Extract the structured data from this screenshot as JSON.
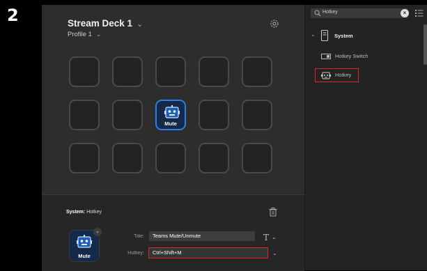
{
  "step_number": "2",
  "deck": {
    "title": "Stream Deck 1",
    "profile": "Profile 1"
  },
  "keys": [
    {
      "label": ""
    },
    {
      "label": ""
    },
    {
      "label": ""
    },
    {
      "label": ""
    },
    {
      "label": ""
    },
    {
      "label": ""
    },
    {
      "label": ""
    },
    {
      "label": "Mute",
      "icon": "robot-icon"
    },
    {
      "label": ""
    },
    {
      "label": ""
    },
    {
      "label": ""
    },
    {
      "label": ""
    },
    {
      "label": ""
    },
    {
      "label": ""
    },
    {
      "label": ""
    }
  ],
  "inspector": {
    "category": "System:",
    "action": "Hotkey",
    "preview_label": "Mute",
    "title_label": "Title:",
    "title_value": "Teams Mute/Unmute",
    "hotkey_label": "Hotkey:",
    "hotkey_value": "Ctrl+Shift+M"
  },
  "actions_panel": {
    "search_value": "Hotkey",
    "category": "System",
    "items": [
      {
        "label": "Hotkey Switch",
        "icon": "hotkey-switch-icon"
      },
      {
        "label": "Hotkey",
        "icon": "hotkey-icon",
        "highlighted": true
      }
    ]
  },
  "colors": {
    "accent": "#2f7fe0",
    "highlight": "#dd2233"
  }
}
